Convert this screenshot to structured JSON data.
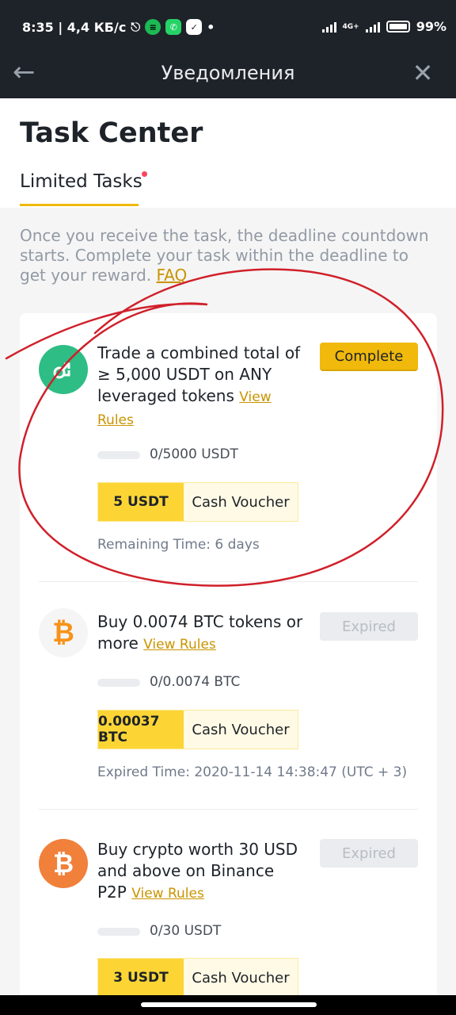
{
  "status": {
    "time_net": "8:35 | 4,4 КБ/с",
    "network": "4G+",
    "battery": "99%"
  },
  "appbar": {
    "title": "Уведомления"
  },
  "header": {
    "title": "Task Center",
    "tab": "Limited Tasks"
  },
  "info": {
    "text": "Once you receive the task, the deadline countdown starts. Complete your task within the deadline to get your reward.",
    "faq": "FAQ"
  },
  "tasks": [
    {
      "title": "Trade a combined total of ≥ 5,000 USDT on ANY leveraged tokens",
      "rules": "View Rules",
      "button": "Complete",
      "progress_value": 0,
      "progress_text": "0/5000 USDT",
      "reward_amount": "5 USDT",
      "reward_type": "Cash Voucher",
      "time_text": "Remaining Time: 6 days",
      "icon": "leveraged-token-icon",
      "icon_color": "#2ebd85"
    },
    {
      "title": "Buy 0.0074 BTC tokens or more",
      "rules": "View Rules",
      "button": "Expired",
      "progress_value": 0,
      "progress_text": "0/0.0074 BTC",
      "reward_amount": "0.00037 BTC",
      "reward_type": "Cash Voucher",
      "time_text": "Expired Time: 2020-11-14 14:38:47 (UTC + 3)",
      "icon": "bitcoin-icon",
      "icon_color": "#f7931a"
    },
    {
      "title": "Buy crypto worth 30 USD and above on Binance P2P",
      "rules": "View Rules",
      "button": "Expired",
      "progress_value": 0,
      "progress_text": "0/30 USDT",
      "reward_amount": "3 USDT",
      "reward_type": "Cash Voucher",
      "icon": "bitcoin-icon",
      "icon_color": "#f0803a"
    }
  ],
  "colors": {
    "accent": "#f0b90b",
    "annotation": "#d0202a"
  }
}
